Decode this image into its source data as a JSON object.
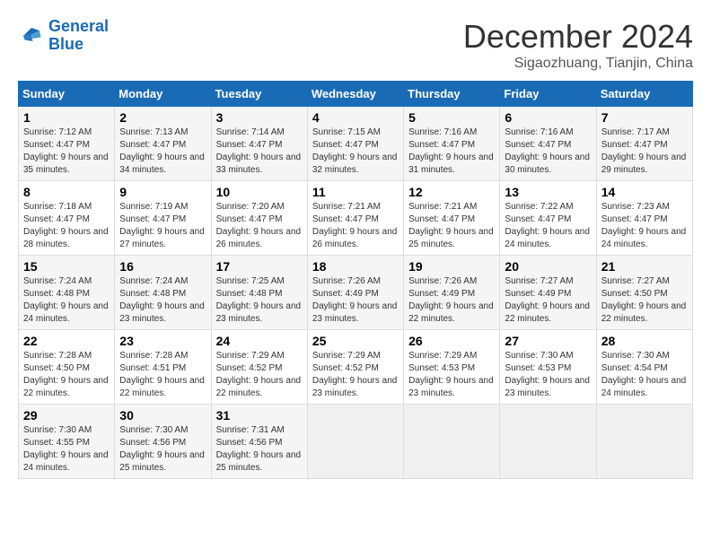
{
  "header": {
    "logo_line1": "General",
    "logo_line2": "Blue",
    "month": "December 2024",
    "location": "Sigaozhuang, Tianjin, China"
  },
  "days_of_week": [
    "Sunday",
    "Monday",
    "Tuesday",
    "Wednesday",
    "Thursday",
    "Friday",
    "Saturday"
  ],
  "weeks": [
    [
      {
        "day": 1,
        "info": "Sunrise: 7:12 AM\nSunset: 4:47 PM\nDaylight: 9 hours\nand 35 minutes."
      },
      {
        "day": 2,
        "info": "Sunrise: 7:13 AM\nSunset: 4:47 PM\nDaylight: 9 hours\nand 34 minutes."
      },
      {
        "day": 3,
        "info": "Sunrise: 7:14 AM\nSunset: 4:47 PM\nDaylight: 9 hours\nand 33 minutes."
      },
      {
        "day": 4,
        "info": "Sunrise: 7:15 AM\nSunset: 4:47 PM\nDaylight: 9 hours\nand 32 minutes."
      },
      {
        "day": 5,
        "info": "Sunrise: 7:16 AM\nSunset: 4:47 PM\nDaylight: 9 hours\nand 31 minutes."
      },
      {
        "day": 6,
        "info": "Sunrise: 7:16 AM\nSunset: 4:47 PM\nDaylight: 9 hours\nand 30 minutes."
      },
      {
        "day": 7,
        "info": "Sunrise: 7:17 AM\nSunset: 4:47 PM\nDaylight: 9 hours\nand 29 minutes."
      }
    ],
    [
      {
        "day": 8,
        "info": "Sunrise: 7:18 AM\nSunset: 4:47 PM\nDaylight: 9 hours\nand 28 minutes."
      },
      {
        "day": 9,
        "info": "Sunrise: 7:19 AM\nSunset: 4:47 PM\nDaylight: 9 hours\nand 27 minutes."
      },
      {
        "day": 10,
        "info": "Sunrise: 7:20 AM\nSunset: 4:47 PM\nDaylight: 9 hours\nand 26 minutes."
      },
      {
        "day": 11,
        "info": "Sunrise: 7:21 AM\nSunset: 4:47 PM\nDaylight: 9 hours\nand 26 minutes."
      },
      {
        "day": 12,
        "info": "Sunrise: 7:21 AM\nSunset: 4:47 PM\nDaylight: 9 hours\nand 25 minutes."
      },
      {
        "day": 13,
        "info": "Sunrise: 7:22 AM\nSunset: 4:47 PM\nDaylight: 9 hours\nand 24 minutes."
      },
      {
        "day": 14,
        "info": "Sunrise: 7:23 AM\nSunset: 4:47 PM\nDaylight: 9 hours\nand 24 minutes."
      }
    ],
    [
      {
        "day": 15,
        "info": "Sunrise: 7:24 AM\nSunset: 4:48 PM\nDaylight: 9 hours\nand 24 minutes."
      },
      {
        "day": 16,
        "info": "Sunrise: 7:24 AM\nSunset: 4:48 PM\nDaylight: 9 hours\nand 23 minutes."
      },
      {
        "day": 17,
        "info": "Sunrise: 7:25 AM\nSunset: 4:48 PM\nDaylight: 9 hours\nand 23 minutes."
      },
      {
        "day": 18,
        "info": "Sunrise: 7:26 AM\nSunset: 4:49 PM\nDaylight: 9 hours\nand 23 minutes."
      },
      {
        "day": 19,
        "info": "Sunrise: 7:26 AM\nSunset: 4:49 PM\nDaylight: 9 hours\nand 22 minutes."
      },
      {
        "day": 20,
        "info": "Sunrise: 7:27 AM\nSunset: 4:49 PM\nDaylight: 9 hours\nand 22 minutes."
      },
      {
        "day": 21,
        "info": "Sunrise: 7:27 AM\nSunset: 4:50 PM\nDaylight: 9 hours\nand 22 minutes."
      }
    ],
    [
      {
        "day": 22,
        "info": "Sunrise: 7:28 AM\nSunset: 4:50 PM\nDaylight: 9 hours\nand 22 minutes."
      },
      {
        "day": 23,
        "info": "Sunrise: 7:28 AM\nSunset: 4:51 PM\nDaylight: 9 hours\nand 22 minutes."
      },
      {
        "day": 24,
        "info": "Sunrise: 7:29 AM\nSunset: 4:52 PM\nDaylight: 9 hours\nand 22 minutes."
      },
      {
        "day": 25,
        "info": "Sunrise: 7:29 AM\nSunset: 4:52 PM\nDaylight: 9 hours\nand 23 minutes."
      },
      {
        "day": 26,
        "info": "Sunrise: 7:29 AM\nSunset: 4:53 PM\nDaylight: 9 hours\nand 23 minutes."
      },
      {
        "day": 27,
        "info": "Sunrise: 7:30 AM\nSunset: 4:53 PM\nDaylight: 9 hours\nand 23 minutes."
      },
      {
        "day": 28,
        "info": "Sunrise: 7:30 AM\nSunset: 4:54 PM\nDaylight: 9 hours\nand 24 minutes."
      }
    ],
    [
      {
        "day": 29,
        "info": "Sunrise: 7:30 AM\nSunset: 4:55 PM\nDaylight: 9 hours\nand 24 minutes."
      },
      {
        "day": 30,
        "info": "Sunrise: 7:30 AM\nSunset: 4:56 PM\nDaylight: 9 hours\nand 25 minutes."
      },
      {
        "day": 31,
        "info": "Sunrise: 7:31 AM\nSunset: 4:56 PM\nDaylight: 9 hours\nand 25 minutes."
      },
      null,
      null,
      null,
      null
    ]
  ]
}
